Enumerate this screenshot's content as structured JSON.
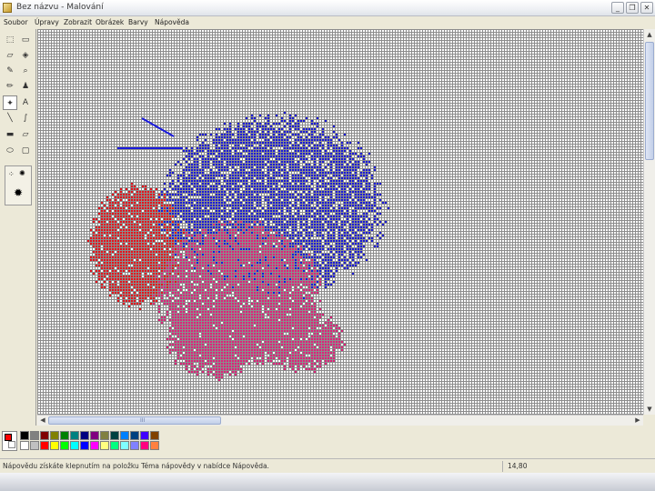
{
  "window": {
    "title": "Bez názvu - Malování",
    "minimize_glyph": "_",
    "maximize_glyph": "❐",
    "close_glyph": "✕",
    "app_icon": "paint-icon"
  },
  "menu": [
    {
      "label": "Soubor"
    },
    {
      "label": "Úpravy"
    },
    {
      "label": "Zobrazit"
    },
    {
      "label": "Obrázek"
    },
    {
      "label": "Barvy"
    },
    {
      "label": "Nápověda"
    }
  ],
  "tools": [
    {
      "name": "free-select-icon",
      "glyph": "⬚"
    },
    {
      "name": "rect-select-icon",
      "glyph": "▭"
    },
    {
      "name": "eraser-icon",
      "glyph": "▱"
    },
    {
      "name": "fill-icon",
      "glyph": "◈"
    },
    {
      "name": "color-picker-icon",
      "glyph": "✎"
    },
    {
      "name": "magnifier-icon",
      "glyph": "⌕"
    },
    {
      "name": "pencil-icon",
      "glyph": "✏"
    },
    {
      "name": "brush-icon",
      "glyph": "♟"
    },
    {
      "name": "airbrush-icon",
      "glyph": "✦"
    },
    {
      "name": "text-icon",
      "glyph": "A"
    },
    {
      "name": "line-icon",
      "glyph": "╲"
    },
    {
      "name": "curve-icon",
      "glyph": "∫"
    },
    {
      "name": "rectangle-icon",
      "glyph": "▬"
    },
    {
      "name": "polygon-icon",
      "glyph": "▱"
    },
    {
      "name": "ellipse-icon",
      "glyph": "⬭"
    },
    {
      "name": "rounded-rect-icon",
      "glyph": "▢"
    }
  ],
  "active_tool": "airbrush-icon",
  "tool_options": [
    {
      "name": "airbrush-small-icon",
      "glyph": "⁘"
    },
    {
      "name": "airbrush-medium-icon",
      "glyph": "✺"
    },
    {
      "name": "airbrush-large-icon",
      "glyph": "✹"
    }
  ],
  "scrollbars": {
    "up": "▲",
    "down": "▼",
    "left": "◀",
    "right": "▶",
    "grip": "III"
  },
  "colors": {
    "primary": "#ff0000",
    "secondary": "#ffffff",
    "blob_blue": "#1a1adc",
    "blob_red": "#e8101a",
    "blob_pink": "#e0207a"
  },
  "palette": {
    "top": [
      "#000000",
      "#808080",
      "#800000",
      "#808000",
      "#008000",
      "#008080",
      "#000080",
      "#800080",
      "#808040",
      "#004040",
      "#0080ff",
      "#004080",
      "#4000ff",
      "#804000"
    ],
    "bottom": [
      "#ffffff",
      "#c0c0c0",
      "#ff0000",
      "#ffff00",
      "#00ff00",
      "#00ffff",
      "#0000ff",
      "#ff00ff",
      "#ffff80",
      "#00ff80",
      "#80ffff",
      "#8080ff",
      "#ff0080",
      "#ff8040"
    ]
  },
  "status": {
    "help_text": "Nápovědu získáte klepnutím na položku Téma nápovědy v nabídce Nápověda.",
    "coords": "14,80"
  }
}
